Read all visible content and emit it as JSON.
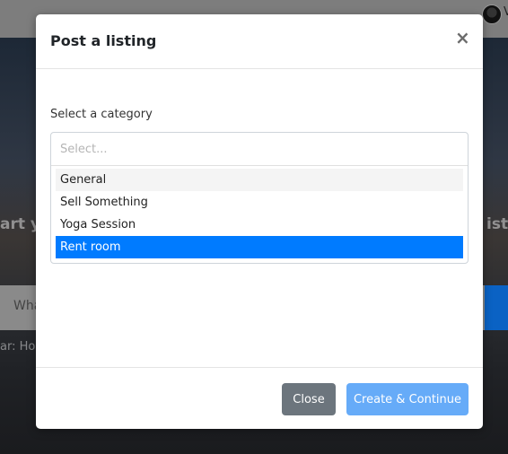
{
  "background": {
    "hero_text_left": "art yo",
    "hero_text_right": "isti",
    "search_text": "Wha",
    "caption": "ar: Hou",
    "avatar_letter": "V"
  },
  "modal": {
    "title": "Post a listing",
    "close_symbol": "×",
    "field_label": "Select a category",
    "select": {
      "placeholder": "Select...",
      "options": [
        {
          "label": "General",
          "state": "hover"
        },
        {
          "label": "Sell Something",
          "state": "normal"
        },
        {
          "label": "Yoga Session",
          "state": "normal"
        },
        {
          "label": "Rent room",
          "state": "selected"
        }
      ]
    },
    "footer": {
      "close_label": "Close",
      "create_label": "Create & Continue"
    }
  },
  "colors": {
    "accent": "#007bff",
    "primary_button": "#66abf8",
    "secondary_button": "#6c757d"
  }
}
